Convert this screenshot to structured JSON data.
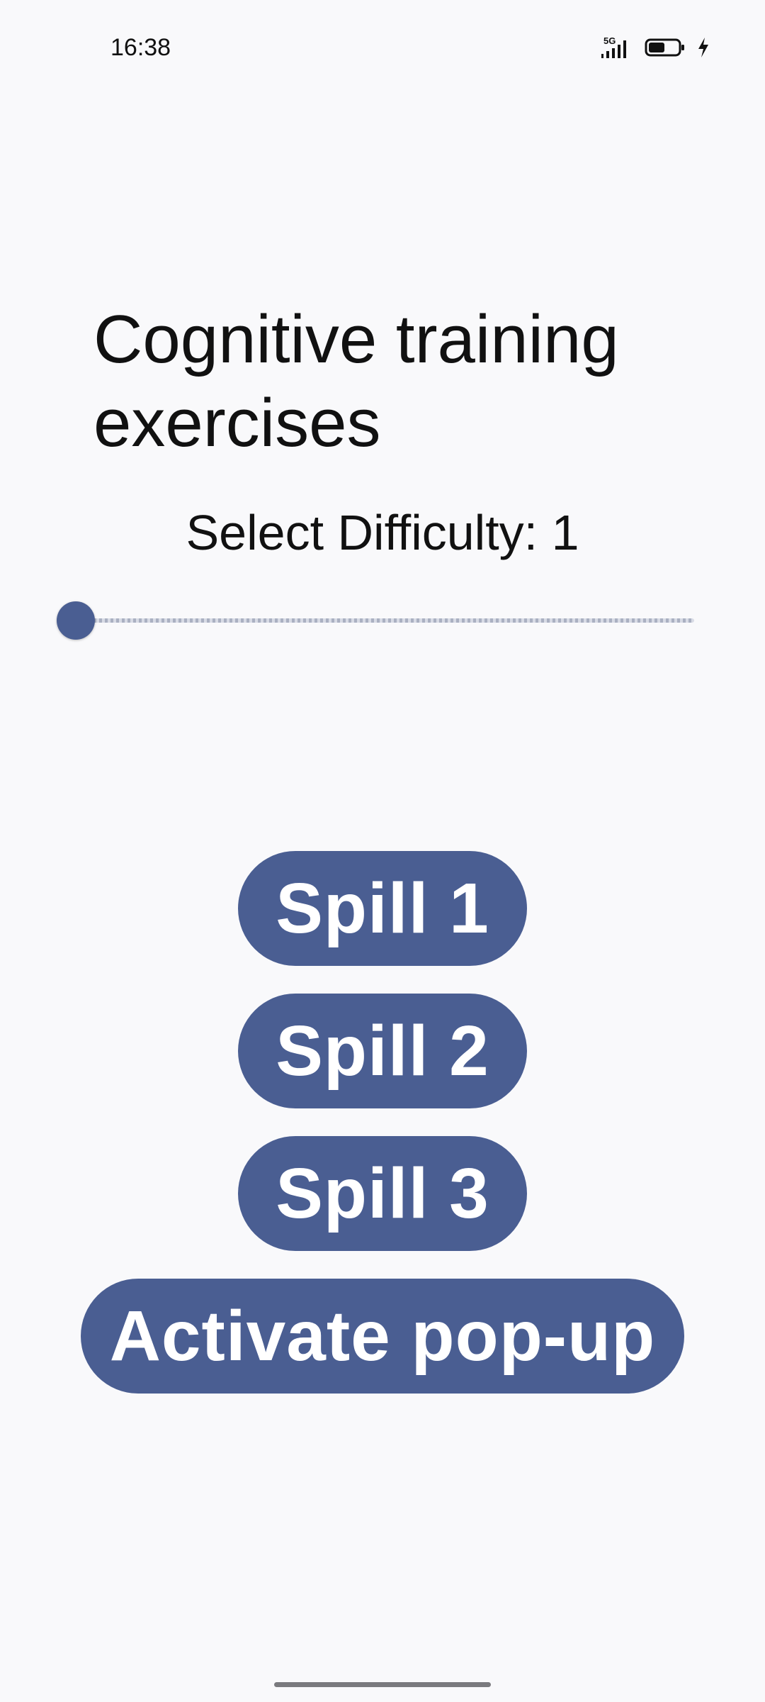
{
  "status_bar": {
    "time": "16:38",
    "network": "5G",
    "battery_level": 0.55,
    "charging": true,
    "icons": [
      "signal-5g-icon",
      "battery-icon",
      "charging-bolt-icon"
    ]
  },
  "header": {
    "title": "Cognitive training exercises"
  },
  "difficulty": {
    "label": "Select Difficulty: 1",
    "value": 1,
    "slider_position": 0.0
  },
  "buttons": {
    "spill1_label": "Spill 1",
    "spill2_label": "Spill 2",
    "spill3_label": "Spill 3",
    "popup_label": "Activate pop-up"
  },
  "colors": {
    "accent": "#4a5e92",
    "background": "#f9f9fb",
    "text": "#111111"
  }
}
